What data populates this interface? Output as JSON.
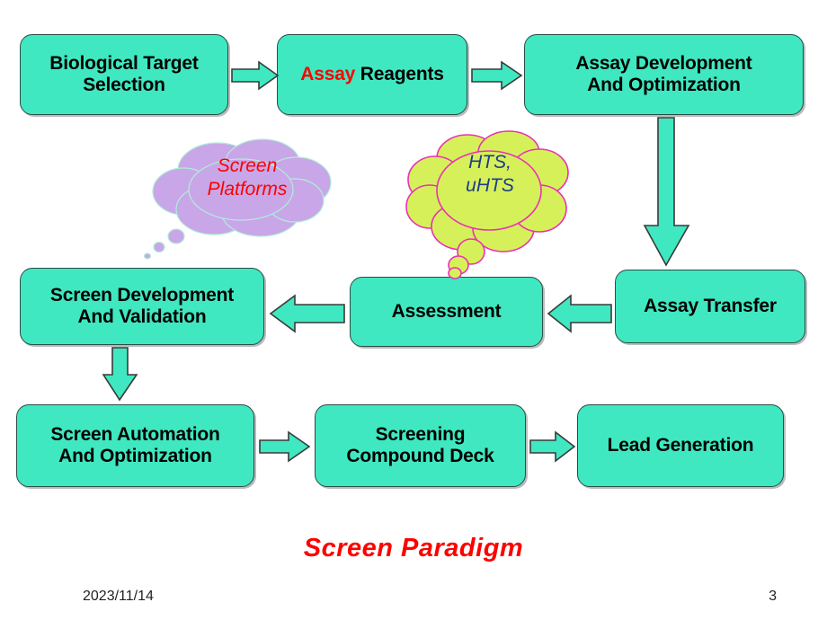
{
  "slide": {
    "caption": "Screen Paradigm",
    "date": "2023/11/14",
    "page_number": "3",
    "background": "#FFFFFF"
  },
  "colors": {
    "box_fill": "#3FE8C0",
    "box_border": "#2A4D46",
    "arrow_fill": "#3FE8C0",
    "arrow_border": "#3A3A3A",
    "highlight_text": "#FF0000",
    "cloud_purple_fill": "#C9A6E8",
    "cloud_purple_border": "#AFEFD8",
    "cloud_green_fill": "#D6F05A",
    "cloud_green_border": "#E832B4",
    "cloud_purple_text": "#FF0000",
    "cloud_green_text": "#1F3C8C",
    "caption_text": "#FF0000",
    "footer_text": "#222222"
  },
  "boxes": [
    {
      "id": "biological-target-selection",
      "label": "Biological Target\nSelection"
    },
    {
      "id": "assay-reagents",
      "label_highlight": "Assay",
      "label_rest": " Reagents"
    },
    {
      "id": "assay-development-and-optimization",
      "label": "Assay Development\nAnd Optimization"
    },
    {
      "id": "assay-transfer",
      "label": "Assay Transfer"
    },
    {
      "id": "assessment",
      "label": "Assessment"
    },
    {
      "id": "screen-development-and-validation",
      "label": "Screen Development\nAnd Validation"
    },
    {
      "id": "screen-automation-and-optimization",
      "label": "Screen Automation\nAnd Optimization"
    },
    {
      "id": "screening-compound-deck",
      "label": "Screening\nCompound Deck"
    },
    {
      "id": "lead-generation",
      "label": "Lead Generation"
    }
  ],
  "clouds": [
    {
      "id": "screen-platforms",
      "text": "Screen\nPlatforms"
    },
    {
      "id": "hts-uhts",
      "text": "HTS,\nuHTS"
    }
  ],
  "arrows": [
    {
      "id": "biological-target-to-assay-reagents",
      "direction": "right"
    },
    {
      "id": "assay-reagents-to-assay-development",
      "direction": "right"
    },
    {
      "id": "assay-development-to-assay-transfer",
      "direction": "down"
    },
    {
      "id": "assay-transfer-to-assessment",
      "direction": "left"
    },
    {
      "id": "assessment-to-screen-development",
      "direction": "left"
    },
    {
      "id": "screen-development-to-screen-automation",
      "direction": "down"
    },
    {
      "id": "screen-automation-to-screening-compound-deck",
      "direction": "right"
    },
    {
      "id": "screening-compound-deck-to-lead-generation",
      "direction": "right"
    }
  ]
}
